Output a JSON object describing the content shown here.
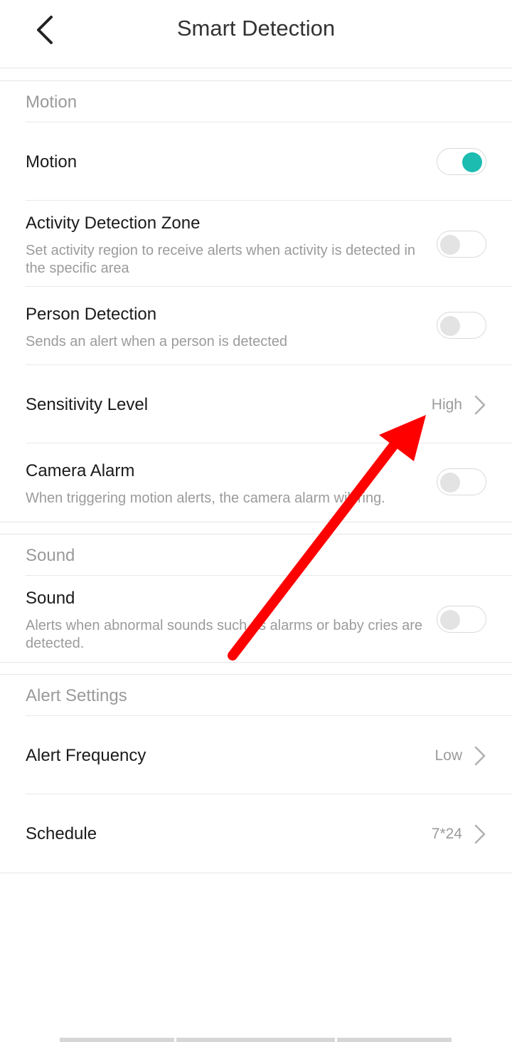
{
  "header": {
    "title": "Smart Detection",
    "back_icon": "chevron-left-icon"
  },
  "sections": [
    {
      "title": "Motion",
      "rows": [
        {
          "title": "Motion",
          "toggle": true
        },
        {
          "title": "Activity Detection Zone",
          "subtitle": "Set activity region to receive alerts when activity is detected in the specific area",
          "toggle": false
        },
        {
          "title": "Person Detection",
          "subtitle": "Sends an alert when a person is detected",
          "toggle": false
        },
        {
          "title": "Sensitivity Level",
          "value": "High"
        },
        {
          "title": "Camera Alarm",
          "subtitle": "When triggering motion alerts, the camera alarm will ring.",
          "toggle": false
        }
      ]
    },
    {
      "title": "Sound",
      "rows": [
        {
          "title": "Sound",
          "subtitle": "Alerts when abnormal sounds such as alarms or baby cries are detected.",
          "toggle": false
        }
      ]
    },
    {
      "title": "Alert Settings",
      "rows": [
        {
          "title": "Alert Frequency",
          "value": "Low"
        },
        {
          "title": "Schedule",
          "value": "7*24"
        }
      ]
    }
  ],
  "colors": {
    "toggle_on": "#1cbcb0",
    "annotation_arrow": "#ff0000"
  }
}
